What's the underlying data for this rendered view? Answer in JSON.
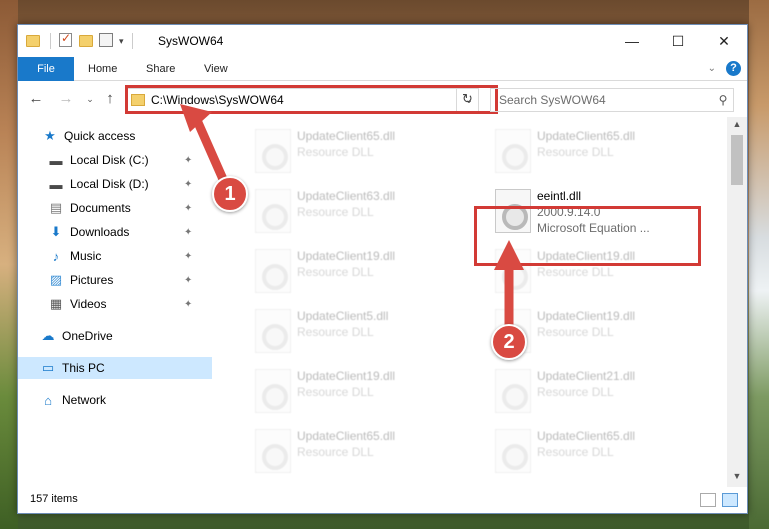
{
  "window": {
    "title": "SysWOW64",
    "minimize_glyph": "—",
    "maximize_glyph": "☐",
    "close_glyph": "✕"
  },
  "ribbon": {
    "tabs": [
      {
        "label": "File"
      },
      {
        "label": "Home"
      },
      {
        "label": "Share"
      },
      {
        "label": "View"
      }
    ],
    "help_glyph": "?",
    "collapse_glyph": "⌄"
  },
  "address_bar": {
    "back_glyph": "←",
    "forward_glyph": "→",
    "recent_glyph": "⌄",
    "up_glyph": "↑",
    "path": "C:\\Windows\\SysWOW64",
    "dropdown_glyph": "⌄",
    "refresh_glyph": "↻",
    "highlight_color": "#d23a35"
  },
  "search": {
    "placeholder": "Search SysWOW64",
    "icon": "search-icon",
    "glyph": "⚲"
  },
  "sidebar": {
    "items": [
      {
        "label": "Quick access",
        "icon": "star-icon",
        "glyph": "★",
        "pinned": false
      },
      {
        "label": "Local Disk (C:)",
        "icon": "drive-icon",
        "glyph": "▬",
        "pinned": true
      },
      {
        "label": "Local Disk (D:)",
        "icon": "drive-icon",
        "glyph": "▬",
        "pinned": true
      },
      {
        "label": "Documents",
        "icon": "documents-icon",
        "glyph": "▤",
        "pinned": true
      },
      {
        "label": "Downloads",
        "icon": "download-icon",
        "glyph": "⬇",
        "pinned": true
      },
      {
        "label": "Music",
        "icon": "music-icon",
        "glyph": "♪",
        "pinned": true
      },
      {
        "label": "Pictures",
        "icon": "pictures-icon",
        "glyph": "▨",
        "pinned": true
      },
      {
        "label": "Videos",
        "icon": "videos-icon",
        "glyph": "▦",
        "pinned": true
      },
      {
        "label": "OneDrive",
        "icon": "onedrive-icon",
        "glyph": "☁",
        "pinned": false
      },
      {
        "label": "This PC",
        "icon": "this-pc-icon",
        "glyph": "▭",
        "pinned": false,
        "selected": true
      },
      {
        "label": "Network",
        "icon": "network-icon",
        "glyph": "⌂",
        "pinned": false
      }
    ],
    "pin_glyph": "✦"
  },
  "files": [
    {
      "name": "UpdateClient65.dll",
      "desc": "Resource DLL",
      "faded": true
    },
    {
      "name": "UpdateClient65.dll",
      "desc": "Resource DLL",
      "faded": true
    },
    {
      "name": "UpdateClient63.dll",
      "desc": "Resource DLL",
      "faded": true
    },
    {
      "name": "eeintl.dll",
      "desc": "2000.9.14.0",
      "extra": "Microsoft Equation ...",
      "faded": false,
      "highlighted": true
    },
    {
      "name": "UpdateClient19.dll",
      "desc": "Resource DLL",
      "faded": true
    },
    {
      "name": "UpdateClient19.dll",
      "desc": "Resource DLL",
      "faded": true
    },
    {
      "name": "UpdateClient5.dll",
      "desc": "Resource DLL",
      "faded": true
    },
    {
      "name": "UpdateClient19.dll",
      "desc": "Resource DLL",
      "faded": true
    },
    {
      "name": "UpdateClient19.dll",
      "desc": "Resource DLL",
      "faded": true
    },
    {
      "name": "UpdateClient21.dll",
      "desc": "Resource DLL",
      "faded": true
    },
    {
      "name": "UpdateClient65.dll",
      "desc": "Resource DLL",
      "faded": true
    },
    {
      "name": "UpdateClient65.dll",
      "desc": "Resource DLL",
      "faded": true
    }
  ],
  "scrollbar": {
    "up_glyph": "▲",
    "down_glyph": "▼"
  },
  "status": {
    "count": "157 items"
  },
  "annotations": {
    "badge1": "1",
    "badge2": "2",
    "color": "#d94a42"
  }
}
